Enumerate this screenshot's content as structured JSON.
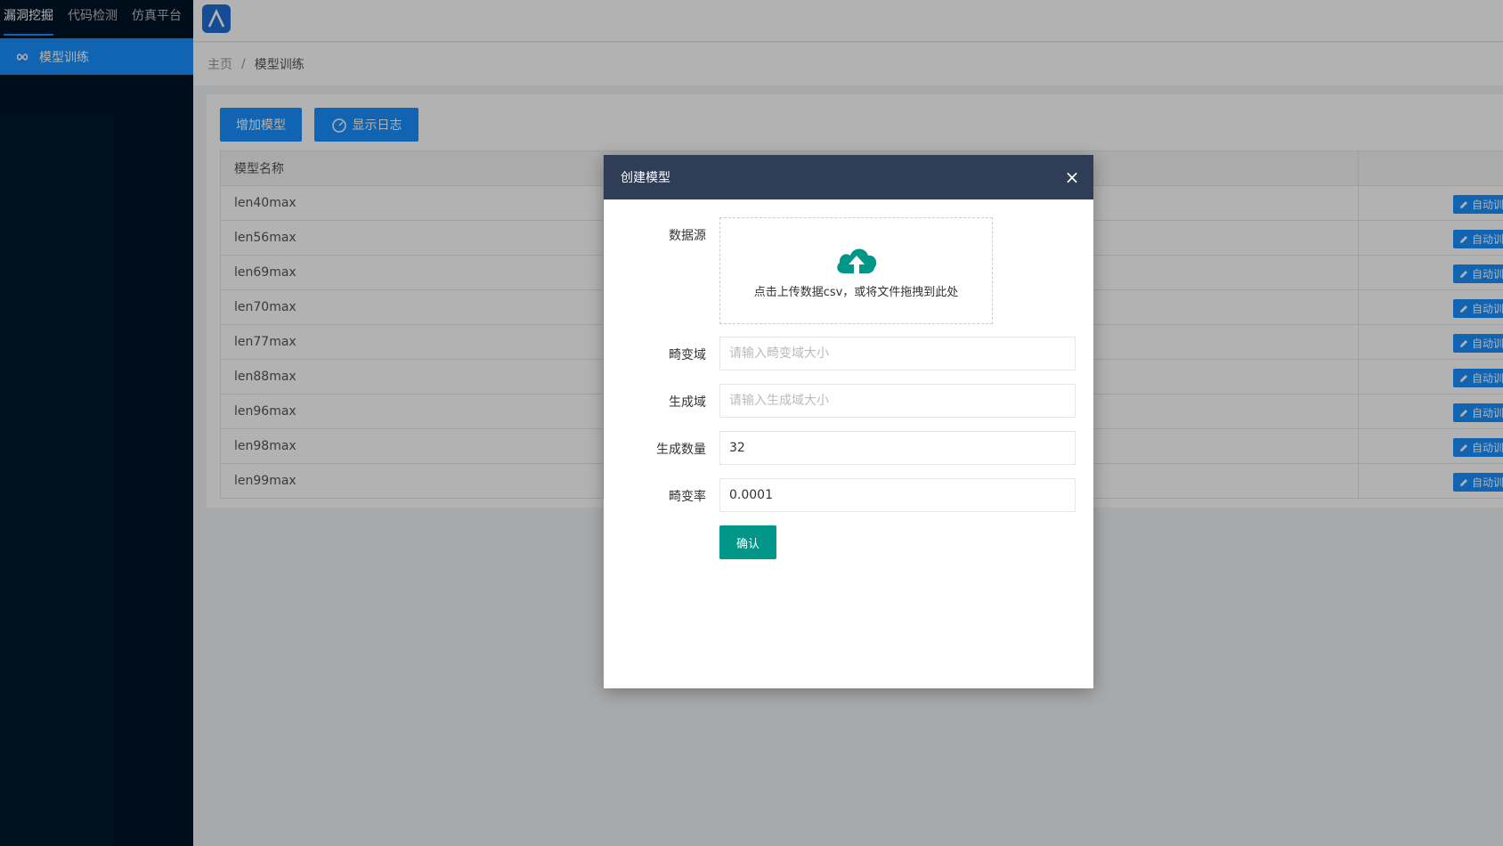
{
  "sidebar": {
    "top_tabs": [
      "漏洞挖掘",
      "代码检测",
      "仿真平台"
    ],
    "menu_item": {
      "label": "模型训练",
      "icon": "infinity-icon"
    }
  },
  "header": {
    "logo_icon": "lambda-logo-icon"
  },
  "breadcrumb": {
    "home": "主页",
    "separator": "/",
    "current": "模型训练"
  },
  "toolbar": {
    "add_model": "增加模型",
    "show_log": "显示日志"
  },
  "table": {
    "header": "模型名称",
    "action_label": "自动训练",
    "rows": [
      "len40max",
      "len56max",
      "len69max",
      "len70max",
      "len77max",
      "len88max",
      "len96max",
      "len98max",
      "len99max"
    ]
  },
  "modal": {
    "title": "创建模型",
    "close": "×",
    "upload_label": "数据源",
    "upload_text": "点击上传数据csv，或将文件拖拽到此处",
    "mutation_domain_label": "畸变域",
    "mutation_domain_placeholder": "请输入畸变域大小",
    "generation_domain_label": "生成域",
    "generation_domain_placeholder": "请输入生成域大小",
    "generation_count_label": "生成数量",
    "generation_count_value": "32",
    "mutation_rate_label": "畸变率",
    "mutation_rate_value": "0.0001",
    "confirm": "确认"
  },
  "colors": {
    "primary": "#1890ff",
    "sidebar": "#001529",
    "modal_header": "#2f3e56",
    "confirm": "#009688",
    "upload_icon": "#009688"
  }
}
